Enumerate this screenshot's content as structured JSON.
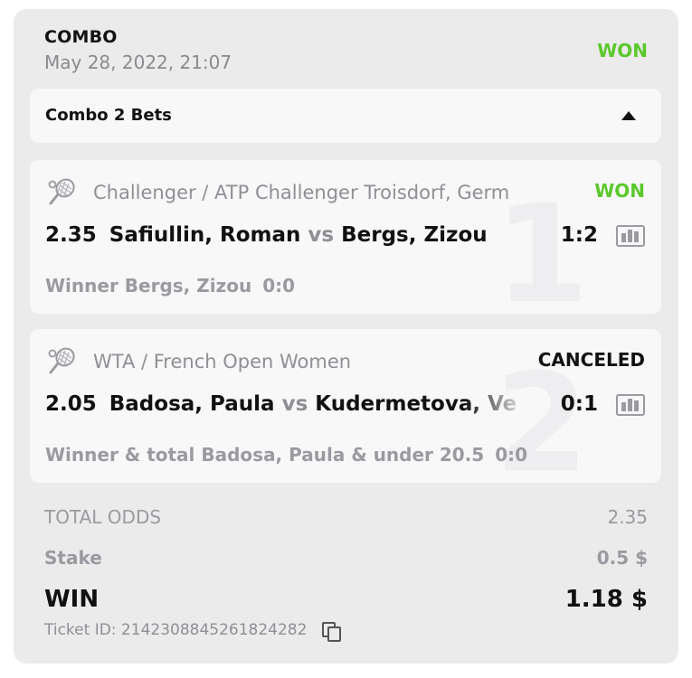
{
  "header": {
    "title": "COMBO",
    "date": "May 28, 2022, 21:07",
    "status": "WON"
  },
  "combo": {
    "label": "Combo 2 Bets"
  },
  "bets": [
    {
      "league": "Challenger / ATP Challenger Troisdorf, Germ",
      "status": "WON",
      "odds": "2.35",
      "home": "Safiullin, Roman",
      "vs": "vs",
      "away": "Bergs, Zizou",
      "score": "1:2",
      "market": "Winner Bergs, Zizou",
      "market_score": "0:0",
      "ghost": "1"
    },
    {
      "league": "WTA / French Open Women",
      "status": "CANCELED",
      "odds": "2.05",
      "home": "Badosa, Paula",
      "vs": "vs",
      "away": "Kudermetova, Vero",
      "score": "0:1",
      "market": "Winner & total Badosa, Paula & under 20.5",
      "market_score": "0:0",
      "ghost": "2"
    }
  ],
  "totals": {
    "odds_label": "TOTAL ODDS",
    "odds_value": "2.35",
    "stake_label": "Stake",
    "stake_value": "0.5 $",
    "win_label": "WIN",
    "win_value": "1.18 $"
  },
  "ticket": {
    "text": "Ticket ID: 2142308845261824282"
  },
  "icons": {
    "sport": "tennis-racket-icon",
    "stats": "stats-chart-icon",
    "copy": "copy-icon",
    "caret": "caret-up-icon"
  },
  "colors": {
    "won": "#5bc82b",
    "card_bg": "#ebebec",
    "panel_bg": "#f8f8f9"
  }
}
